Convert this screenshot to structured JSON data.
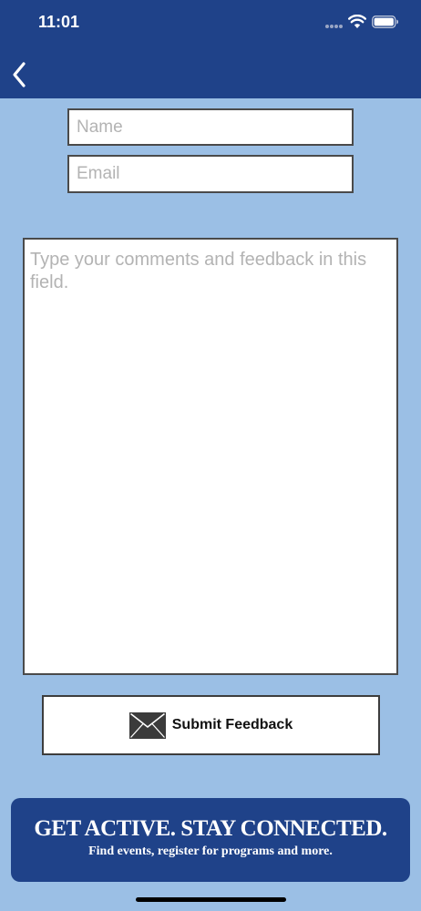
{
  "status_bar": {
    "time": "11:01"
  },
  "nav": {
    "back_icon": "chevron-left-icon"
  },
  "form": {
    "name_placeholder": "Name",
    "name_value": "",
    "email_placeholder": "Email",
    "email_value": "",
    "comments_placeholder": "Type your comments and feedback in this field.",
    "comments_value": ""
  },
  "submit": {
    "icon": "envelope-icon",
    "label": "Submit Feedback"
  },
  "banner": {
    "headline": "GET ACTIVE.  STAY CONNECTED.",
    "subline": "Find events, register for programs and more."
  },
  "colors": {
    "header_bg": "#1f4289",
    "page_bg": "#9bbfe5",
    "banner_bg": "#1f4289"
  }
}
